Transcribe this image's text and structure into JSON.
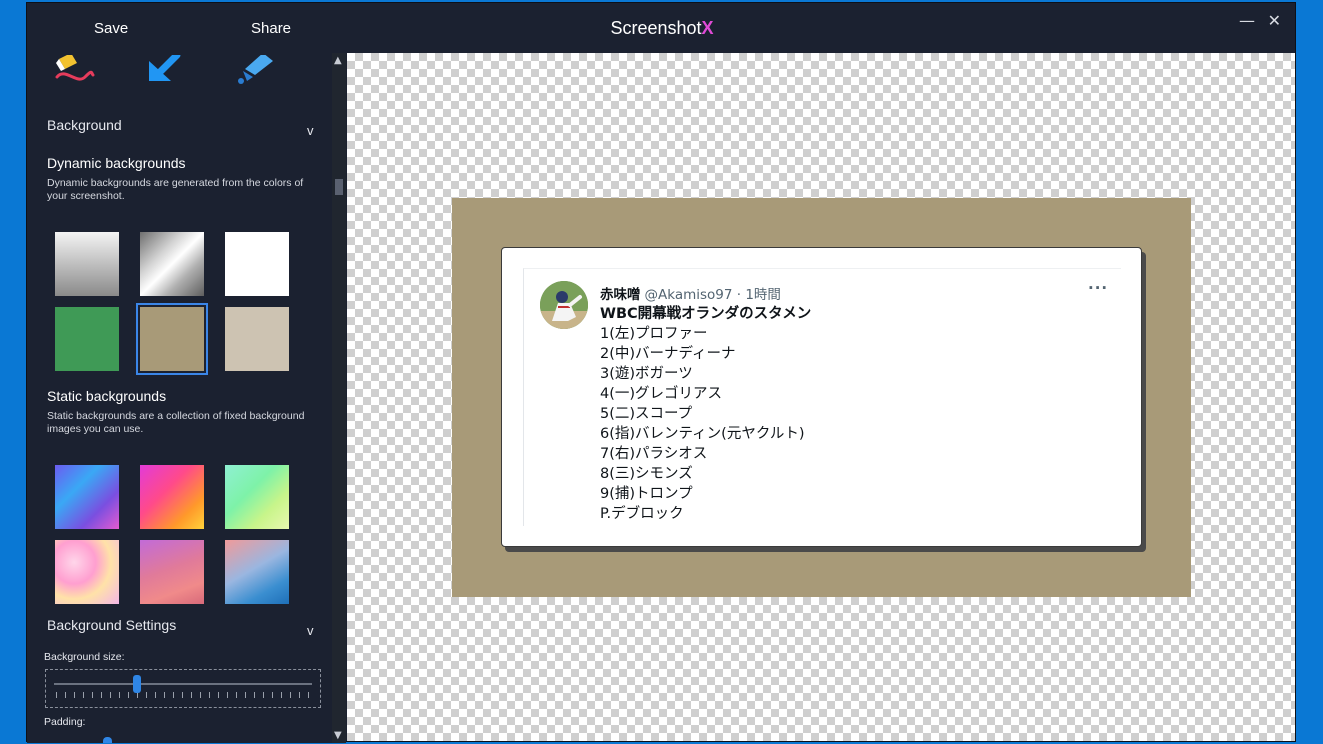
{
  "titlebar": {
    "save_label": "Save",
    "share_label": "Share",
    "app_title": "Screenshot",
    "app_title_suffix": "X",
    "minimize_label": "—",
    "close_label": "✕"
  },
  "sidebar": {
    "background_section": "Background",
    "dynamic_title": "Dynamic backgrounds",
    "dynamic_desc": "Dynamic backgrounds are generated from the colors of your screenshot.",
    "static_title": "Static backgrounds",
    "static_desc": "Static backgrounds are a collection of fixed background images you can use.",
    "settings_section": "Background Settings",
    "size_label": "Background size:",
    "padding_label": "Padding:",
    "chevron": "v",
    "selected_dynamic_color": "#a89a78"
  },
  "tweet": {
    "name": "赤味噌",
    "handle": "@Akamiso97 · 1時間",
    "more": "···",
    "lines": [
      "WBC開幕戦オランダのスタメン",
      "1(左)プロファー",
      "2(中)バーナディーナ",
      "3(遊)ボガーツ",
      "4(一)グレゴリアス",
      "5(二)スコープ",
      "6(指)バレンティン(元ヤクルト)",
      "7(右)パラシオス",
      "8(三)シモンズ",
      "9(捕)トロンプ",
      "P.デブロック"
    ]
  }
}
